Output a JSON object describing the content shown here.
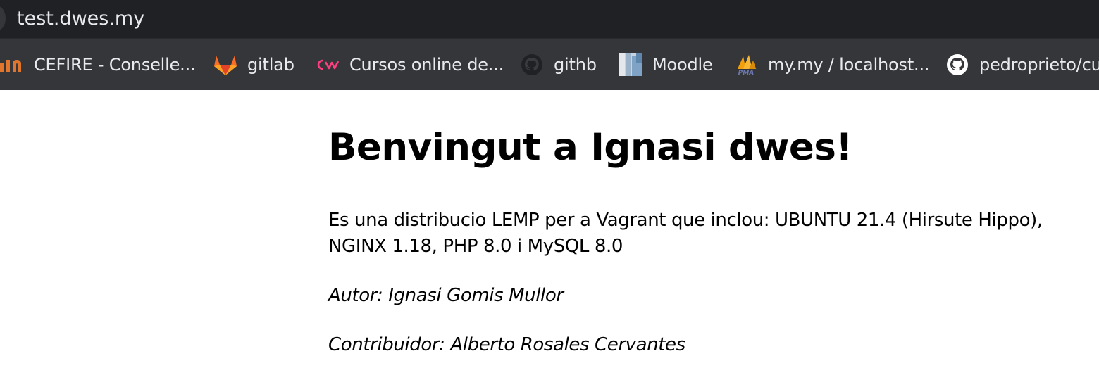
{
  "browser": {
    "url": "test.dwes.my"
  },
  "bookmarks": [
    {
      "label": "CEFIRE - Conselle...",
      "icon": "cefire-logo-icon"
    },
    {
      "label": "gitlab",
      "icon": "gitlab-icon"
    },
    {
      "label": "Cursos online de...",
      "icon": "cursos-logo-icon"
    },
    {
      "label": "githb",
      "icon": "github-icon"
    },
    {
      "label": "Moodle",
      "icon": "moodle-thumbnail-icon"
    },
    {
      "label": "my.my / localhost...",
      "icon": "phpmyadmin-icon"
    },
    {
      "label": "pedroprieto/cur",
      "icon": "github-icon"
    }
  ],
  "page": {
    "title": "Benvingut a Ignasi dwes!",
    "description": "Es una distribucio LEMP per a Vagrant que inclou: UBUNTU 21.4 (Hirsute Hippo), NGINX 1.18, PHP 8.0 i MySQL 8.0",
    "autor": "Autor: Ignasi Gomis Mullor",
    "contribuidor": "Contribuidor: Alberto Rosales Cervantes"
  },
  "colors": {
    "address_bar_bg": "#202124",
    "bookmarks_bar_bg": "#35363a",
    "bookmark_text": "#e8eaed",
    "gitlab_orange": "#e24329",
    "cursos_pink": "#ff3d7f"
  }
}
